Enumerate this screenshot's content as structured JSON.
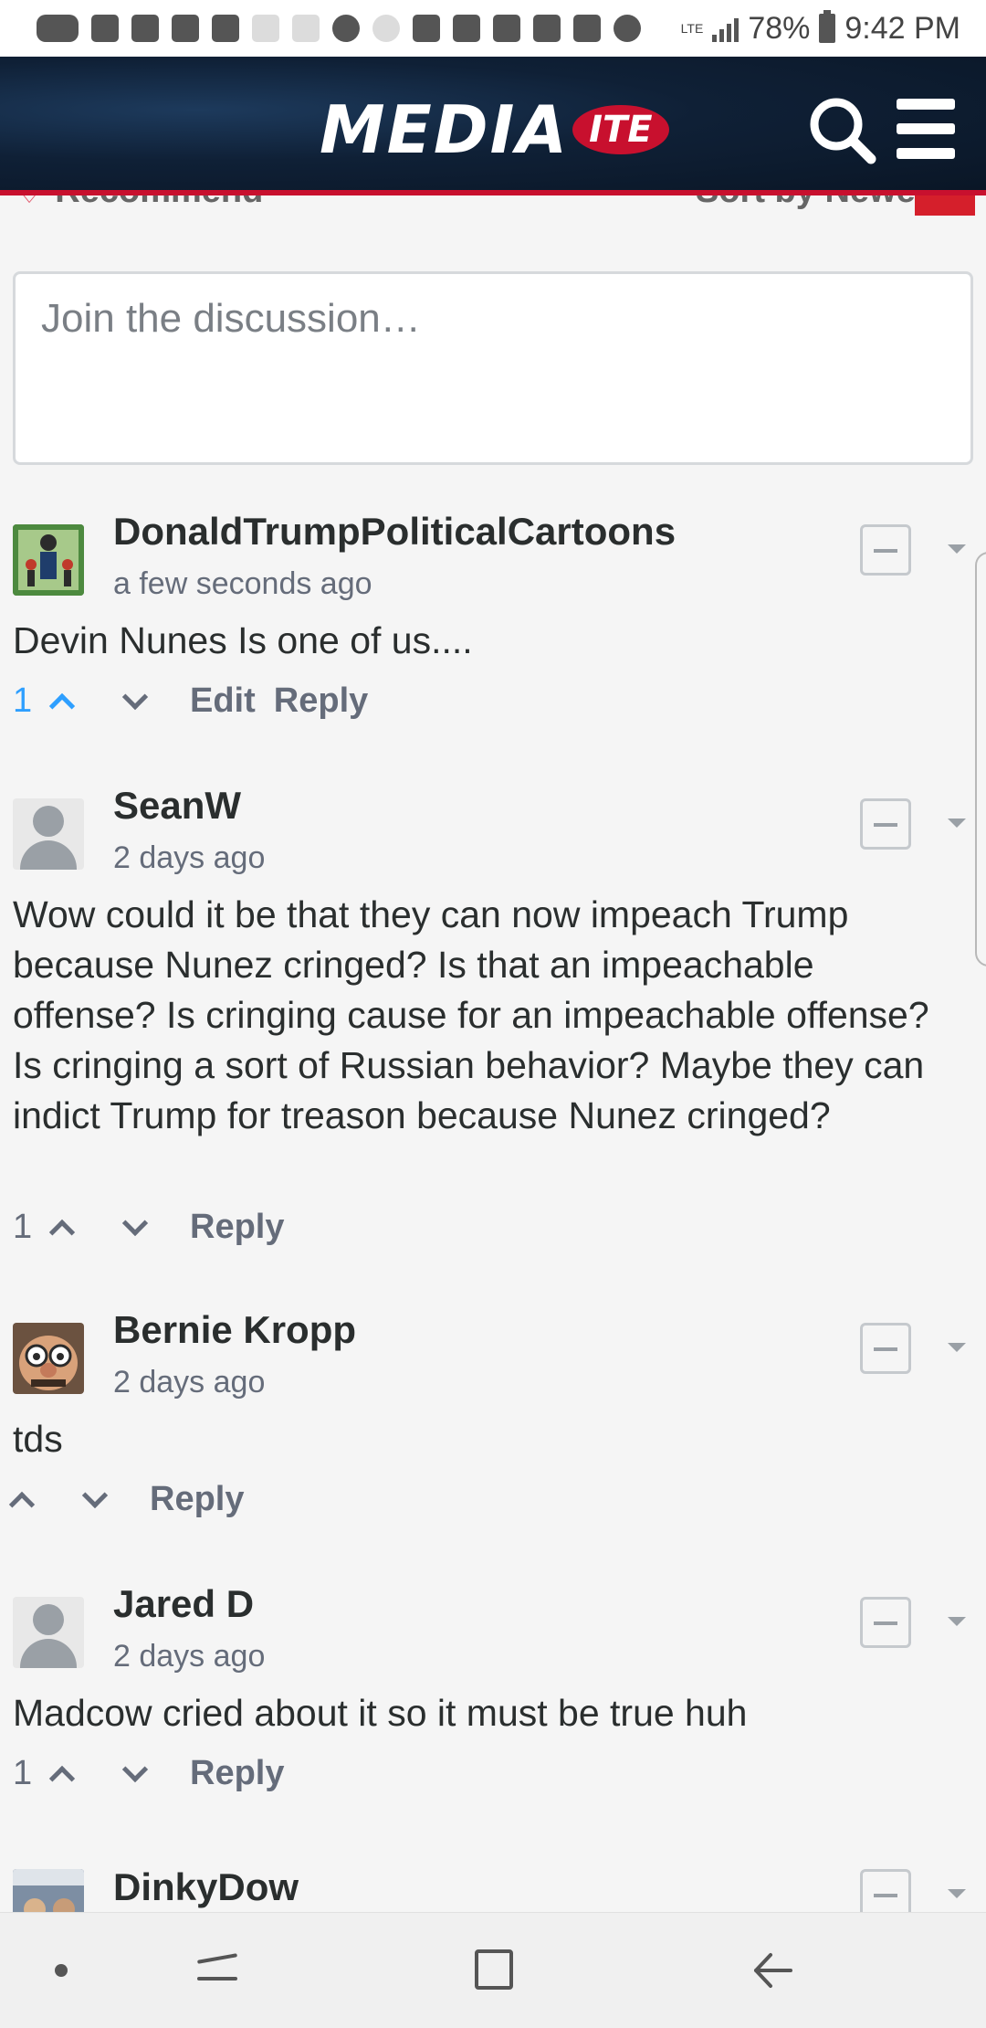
{
  "status_bar": {
    "battery": "78%",
    "time": "9:42 PM",
    "network": "LTE"
  },
  "header": {
    "logo_main": "MEDIA",
    "logo_badge": "ITE",
    "icons": [
      "search-icon",
      "hamburger-menu-icon"
    ]
  },
  "toolbar": {
    "recommend_label": "Recommend",
    "sort_label": "Sort by Newe"
  },
  "compose": {
    "placeholder": "Join the discussion…"
  },
  "comments": [
    {
      "author": "DonaldTrumpPoliticalCartoons",
      "time": "a few seconds ago",
      "text": "Devin Nunes Is one of us....",
      "votes": "1",
      "upvoted": true,
      "edit_label": "Edit",
      "reply_label": "Reply"
    },
    {
      "author": "SeanW",
      "time": "2 days ago",
      "text": "Wow could it be that they can now impeach Trump because Nunez cringed? Is that an impeachable offense? Is cringing cause for an impeachable offense? Is cringing a sort of Russian behavior? Maybe they can indict Trump for treason because Nunez cringed?",
      "votes": "1",
      "upvoted": false,
      "reply_label": "Reply"
    },
    {
      "author": "Bernie Kropp",
      "time": "2 days ago",
      "text": "tds",
      "votes": "",
      "upvoted": false,
      "reply_label": "Reply"
    },
    {
      "author": "Jared D",
      "time": "2 days ago",
      "text": "Madcow cried about it so it must be true huh",
      "votes": "1",
      "upvoted": false,
      "reply_label": "Reply"
    },
    {
      "author": "DinkyDow",
      "time": "",
      "text": ""
    }
  ],
  "colors": {
    "accent_red": "#c8102e",
    "header_bg": "#0f2036",
    "upvote_blue": "#2e9fff"
  }
}
